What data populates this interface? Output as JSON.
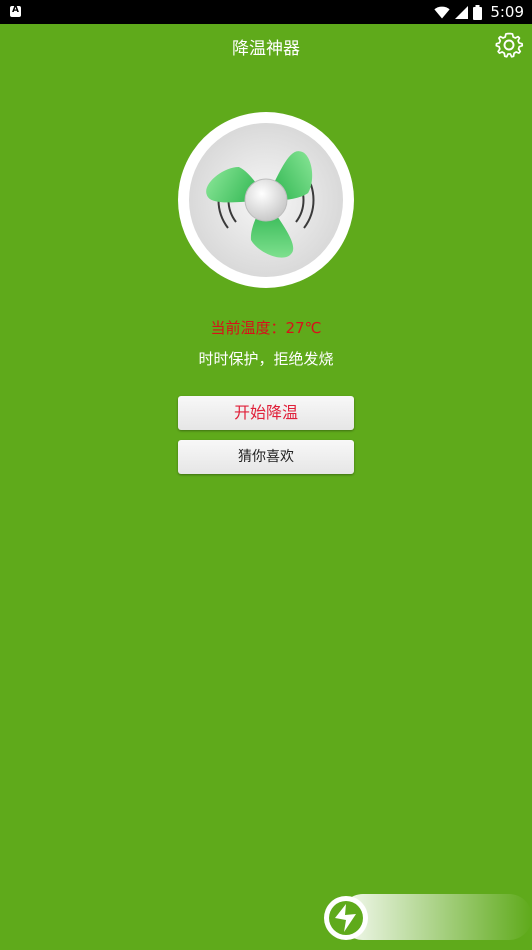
{
  "status_bar": {
    "time": "5:09"
  },
  "app_bar": {
    "title": "降温神器"
  },
  "main": {
    "temperature_label": "当前温度：27℃",
    "subtitle": "时时保护，拒绝发烧"
  },
  "buttons": {
    "start_label": "开始降温",
    "guess_label": "猜你喜欢"
  },
  "icons": {
    "app_notification": "app-notification-icon",
    "wifi": "wifi-icon",
    "signal": "signal-icon",
    "battery": "battery-icon",
    "settings": "gear-icon",
    "fan": "fan-icon",
    "floating_widget": "floating-widget-icon"
  },
  "colors": {
    "background": "#5faa1b",
    "temperature_text": "#d8101a",
    "start_button_text": "#e0203a",
    "fan_blade": "#3ec25a"
  }
}
